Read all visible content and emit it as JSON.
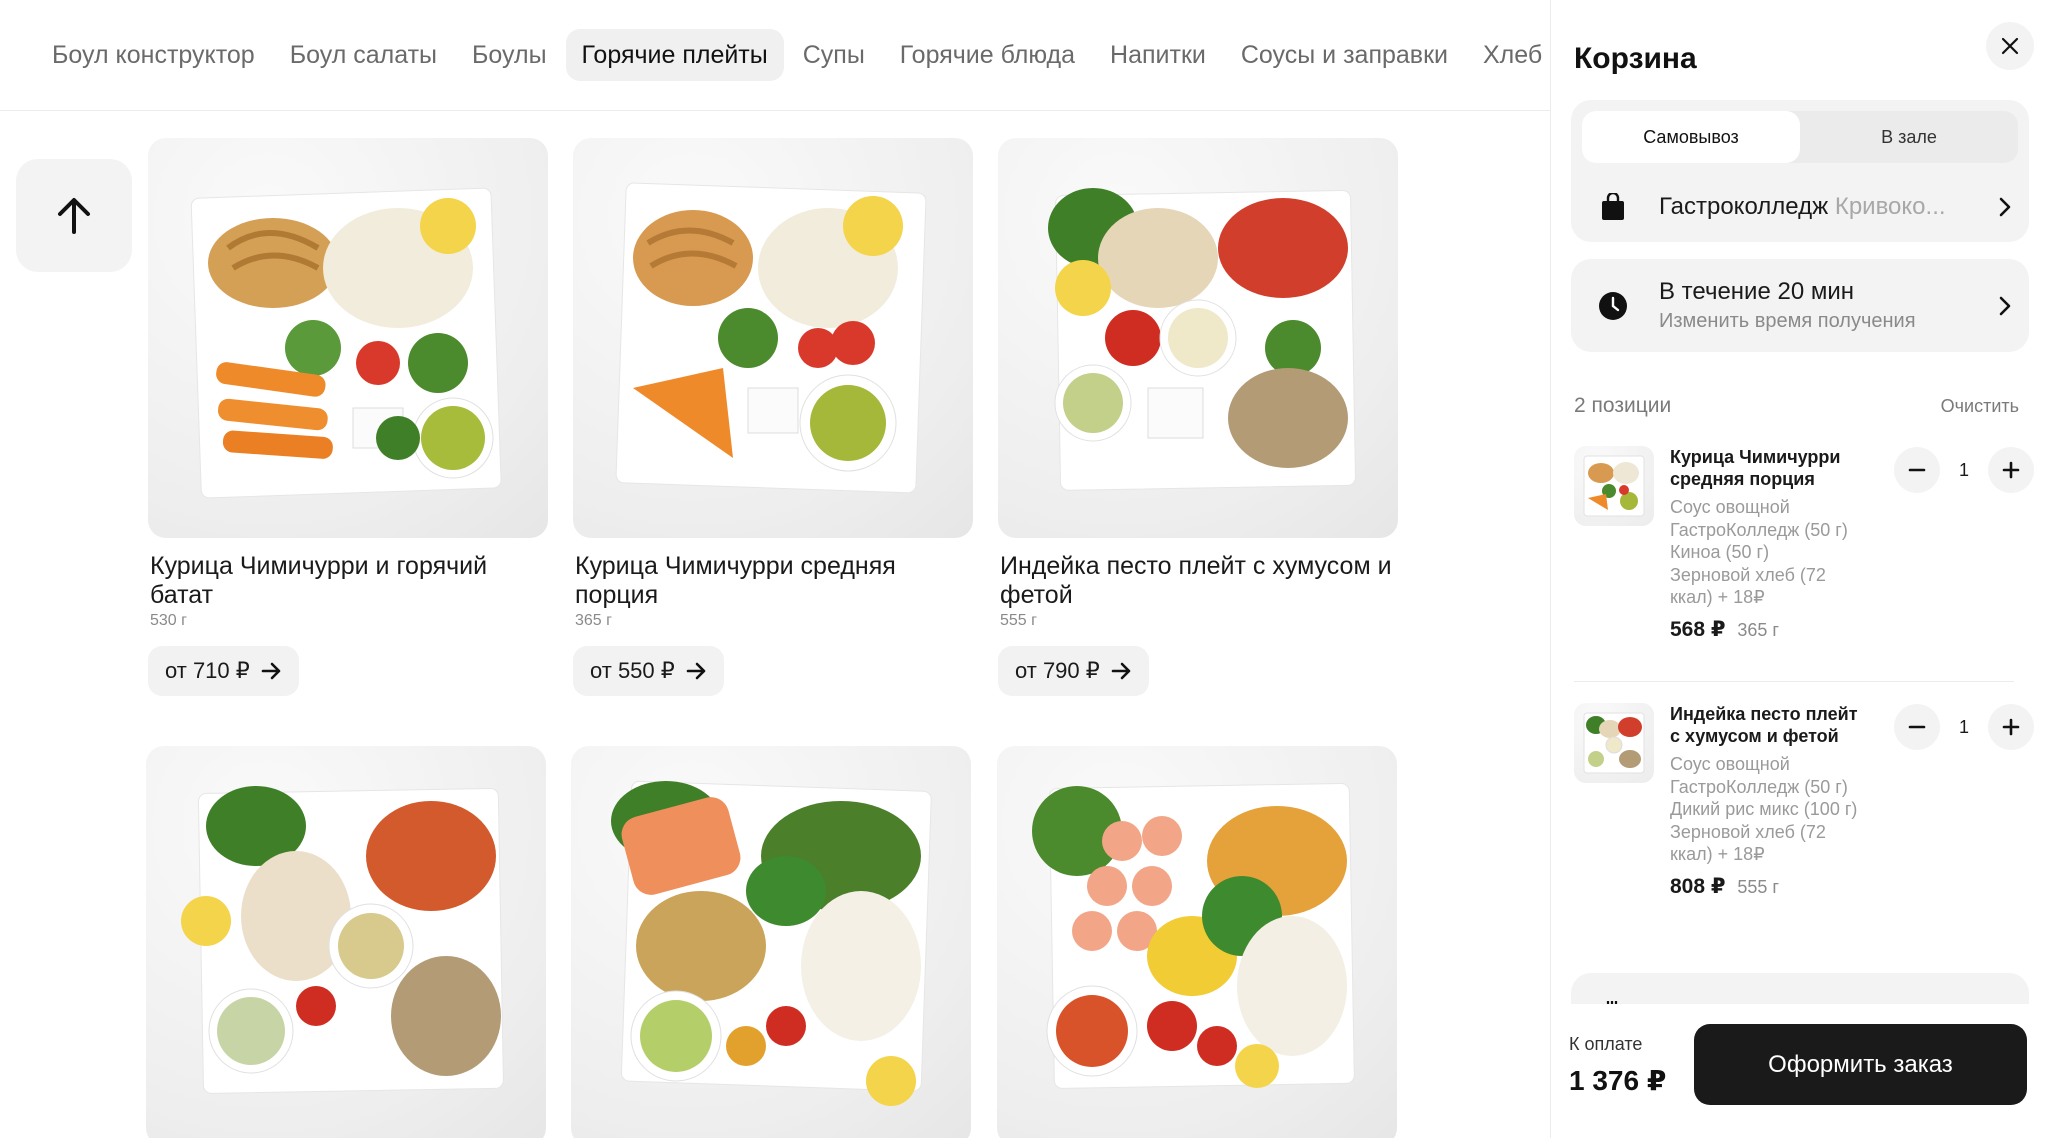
{
  "categories": [
    {
      "label": "Боул конструктор",
      "active": false
    },
    {
      "label": "Боул салаты",
      "active": false
    },
    {
      "label": "Боулы",
      "active": false
    },
    {
      "label": "Горячие плейты",
      "active": true
    },
    {
      "label": "Супы",
      "active": false
    },
    {
      "label": "Горячие блюда",
      "active": false
    },
    {
      "label": "Напитки",
      "active": false
    },
    {
      "label": "Соусы и заправки",
      "active": false
    },
    {
      "label": "Хлеб",
      "active": false
    }
  ],
  "products": [
    {
      "title": "Курица Чимичурри и горячий батат",
      "weight": "530 г",
      "price": "от 710 ₽"
    },
    {
      "title": "Курица Чимичурри средняя порция",
      "weight": "365 г",
      "price": "от 550 ₽"
    },
    {
      "title": "Индейка песто плейт с хумусом и фетой",
      "weight": "555 г",
      "price": "от 790 ₽"
    }
  ],
  "cart": {
    "title": "Корзина",
    "delivery_modes": [
      "Самовывоз",
      "В зале"
    ],
    "active_mode": "Самовывоз",
    "location": {
      "name": "Гастроколледж",
      "address": "Кривоко..."
    },
    "time": {
      "main": "В течение 20 мин",
      "sub": "Изменить время получения"
    },
    "count_label": "2 позиции",
    "clear_label": "Очистить",
    "items": [
      {
        "name": "Курица Чимичурри средняя порция",
        "options": [
          "Соус овощной ГастроКолледж (50 г)",
          "Киноа (50 г)",
          "Зерновой хлеб (72 ккал) + 18₽"
        ],
        "price": "568 ₽",
        "weight": "365 г",
        "qty": "1"
      },
      {
        "name": "Индейка песто плейт с хумусом и фетой",
        "options": [
          "Соус овощной ГастроКолледж (50 г)",
          "Дикий рис микс (100 г)",
          "Зерновой хлеб (72 ккал) + 18₽"
        ],
        "price": "808 ₽",
        "weight": "555 г",
        "qty": "1"
      }
    ],
    "pay_label": "К оплате",
    "total": "1 376 ₽",
    "order_label": "Оформить заказ"
  },
  "icons": {
    "scroll_up": "arrow-up-icon",
    "close": "close-icon",
    "location": "bag-icon",
    "time": "clock-icon",
    "chevron": "chevron-right-icon",
    "price_arrow": "arrow-right-icon"
  }
}
